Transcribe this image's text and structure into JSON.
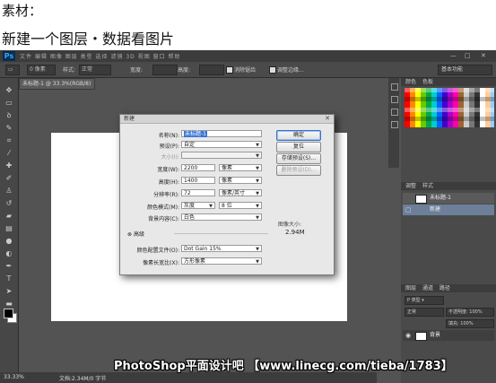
{
  "caption": {
    "line1": "素材：",
    "line2": "新建一个图层・数据看图片"
  },
  "app": {
    "logo": "Ps",
    "menu_text": "文件  编辑  图像  图层  类型  选择  滤镜  3D  视图  窗口  帮助",
    "window_controls": [
      "—",
      "□",
      "✕"
    ],
    "doc_tab": "未标题-1 @ 33.3%(RGB/8)",
    "essentials": "基本功能"
  },
  "options": {
    "style_label": "样式:",
    "style_value": "正常",
    "width_label": "宽度:",
    "height_label": "高度:",
    "feather_value": "0 像素",
    "antialias_label": "消除锯齿",
    "refine_label": "调整边缘..."
  },
  "status": {
    "zoom": "33.33%",
    "doc": "文档:2.34M/0 字节"
  },
  "panels": {
    "swatch_tabs": [
      "颜色",
      "色板"
    ],
    "adjust_tabs": [
      "调整",
      "样式"
    ],
    "layers_tabs": [
      "图层",
      "通道",
      "路径"
    ],
    "layer_mode": "正常",
    "opacity": "不透明度: 100%",
    "fill": "填充: 100%",
    "layer_name": "背景",
    "doc_layer": "未标题-1",
    "sub_layer": "新建"
  },
  "dialog": {
    "title": "新建",
    "close": "✕",
    "name_label": "名称(N):",
    "name_value": "未标题-1",
    "preset_label": "预设(P):",
    "preset_value": "自定",
    "size_label": "大小(I):",
    "width_label": "宽度(W):",
    "width_value": "2200",
    "width_unit": "像素",
    "height_label": "高度(H):",
    "height_value": "1400",
    "height_unit": "像素",
    "res_label": "分辨率(R):",
    "res_value": "72",
    "res_unit": "像素/英寸",
    "mode_label": "颜色模式(M):",
    "mode_value": "灰度",
    "bit_value": "8 位",
    "bg_label": "背景内容(C):",
    "bg_value": "白色",
    "advanced_label": "高级",
    "profile_label": "颜色配置文件(O):",
    "profile_value": "Dot Gain 15%",
    "aspect_label": "像素长宽比(X):",
    "aspect_value": "方形像素",
    "image_size_label": "图像大小:",
    "image_size_value": "2.94M",
    "ok": "确定",
    "cancel": "复位",
    "save_preset": "存储预设(S)...",
    "delete_preset": "删除预设(D)..."
  },
  "watermark": "PhotoShop平面设计吧 【www.linecg.com/tieba/1783】"
}
